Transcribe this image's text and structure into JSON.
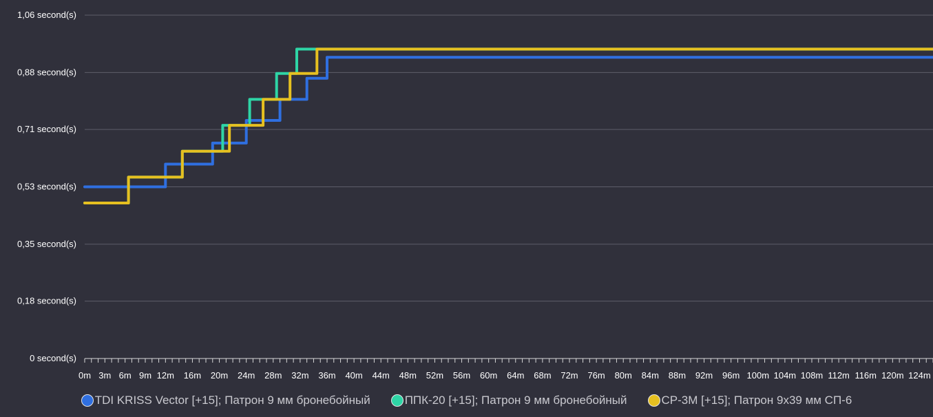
{
  "chart_data": {
    "type": "line",
    "title": "",
    "xlabel": "",
    "ylabel": "",
    "xlim": [
      0,
      126
    ],
    "ylim": [
      0,
      1.06
    ],
    "grid": true,
    "legend_placement": "bottom",
    "y_ticks": [
      {
        "value": 0,
        "label": "0 second(s)"
      },
      {
        "value": 0.177,
        "label": "0,18 second(s)"
      },
      {
        "value": 0.353,
        "label": "0,35 second(s)"
      },
      {
        "value": 0.53,
        "label": "0,53 second(s)"
      },
      {
        "value": 0.707,
        "label": "0,71 second(s)"
      },
      {
        "value": 0.883,
        "label": "0,88 second(s)"
      },
      {
        "value": 1.06,
        "label": "1,06 second(s)"
      }
    ],
    "x_ticks": [
      {
        "value": 0,
        "label": "0m"
      },
      {
        "value": 3,
        "label": "3m"
      },
      {
        "value": 6,
        "label": "6m"
      },
      {
        "value": 9,
        "label": "9m"
      },
      {
        "value": 12,
        "label": "12m"
      },
      {
        "value": 16,
        "label": "16m"
      },
      {
        "value": 20,
        "label": "20m"
      },
      {
        "value": 24,
        "label": "24m"
      },
      {
        "value": 28,
        "label": "28m"
      },
      {
        "value": 32,
        "label": "32m"
      },
      {
        "value": 36,
        "label": "36m"
      },
      {
        "value": 40,
        "label": "40m"
      },
      {
        "value": 44,
        "label": "44m"
      },
      {
        "value": 48,
        "label": "48m"
      },
      {
        "value": 52,
        "label": "52m"
      },
      {
        "value": 56,
        "label": "56m"
      },
      {
        "value": 60,
        "label": "60m"
      },
      {
        "value": 64,
        "label": "64m"
      },
      {
        "value": 68,
        "label": "68m"
      },
      {
        "value": 72,
        "label": "72m"
      },
      {
        "value": 76,
        "label": "76m"
      },
      {
        "value": 80,
        "label": "80m"
      },
      {
        "value": 84,
        "label": "84m"
      },
      {
        "value": 88,
        "label": "88m"
      },
      {
        "value": 92,
        "label": "92m"
      },
      {
        "value": 96,
        "label": "96m"
      },
      {
        "value": 100,
        "label": "100m"
      },
      {
        "value": 104,
        "label": "104m"
      },
      {
        "value": 108,
        "label": "108m"
      },
      {
        "value": 112,
        "label": "112m"
      },
      {
        "value": 116,
        "label": "116m"
      },
      {
        "value": 120,
        "label": "120m"
      },
      {
        "value": 124,
        "label": "124m"
      }
    ],
    "minor_tick_step": 1,
    "series": [
      {
        "name": "TDI KRISS Vector [+15]; Патрон 9 мм бронебойный",
        "color": "#2f6fe0",
        "x": [
          0,
          12,
          12,
          19,
          19,
          24,
          24,
          29,
          29,
          33,
          33,
          36,
          36,
          126
        ],
        "y": [
          0.53,
          0.53,
          0.6,
          0.6,
          0.665,
          0.665,
          0.735,
          0.735,
          0.8,
          0.8,
          0.865,
          0.865,
          0.93,
          0.93
        ]
      },
      {
        "name": "ППК-20 [+15]; Патрон 9 мм бронебойный",
        "color": "#2ed5a6",
        "x": [
          0,
          6.5,
          6.5,
          14.5,
          14.5,
          20.5,
          20.5,
          24.5,
          24.5,
          28.5,
          28.5,
          31.5,
          31.5,
          36,
          36,
          126
        ],
        "y": [
          0.48,
          0.48,
          0.56,
          0.56,
          0.64,
          0.64,
          0.72,
          0.72,
          0.8,
          0.8,
          0.88,
          0.88,
          0.955,
          0.955,
          0.955,
          0.955
        ]
      },
      {
        "name": "СР-3М [+15]; Патрон 9x39 мм СП-6",
        "color": "#e6c020",
        "x": [
          0,
          6.5,
          6.5,
          14.5,
          14.5,
          21.5,
          21.5,
          26.5,
          26.5,
          30.5,
          30.5,
          34.5,
          34.5,
          119,
          119,
          126
        ],
        "y": [
          0.48,
          0.48,
          0.56,
          0.56,
          0.64,
          0.64,
          0.72,
          0.72,
          0.8,
          0.8,
          0.88,
          0.88,
          0.955,
          0.955,
          0.955,
          0.955
        ]
      }
    ]
  }
}
